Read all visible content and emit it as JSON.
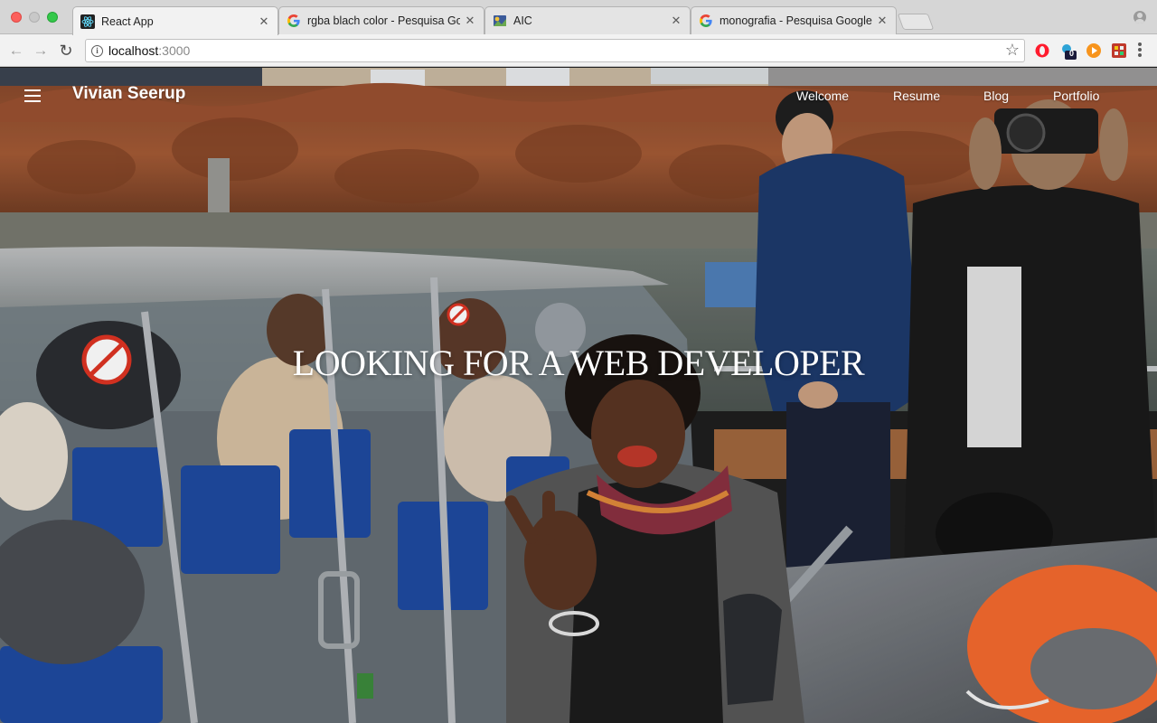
{
  "browser": {
    "tabs": [
      {
        "title": "React App",
        "favicon": "react-icon",
        "active": true
      },
      {
        "title": "rgba blach color - Pesquisa Go",
        "favicon": "google-icon",
        "active": false
      },
      {
        "title": "AIC",
        "favicon": "aic-icon",
        "active": false
      },
      {
        "title": "monografia - Pesquisa Google",
        "favicon": "google-icon",
        "active": false
      }
    ],
    "address": {
      "host": "localhost",
      "port": ":3000"
    },
    "extensions": [
      "opera-icon",
      "extension-badge-icon",
      "play-icon",
      "puzzle-icon"
    ],
    "extension_badge": "0"
  },
  "site": {
    "brand": "Vivian Seerup",
    "nav": [
      {
        "label": "Welcome"
      },
      {
        "label": "Resume"
      },
      {
        "label": "Blog"
      },
      {
        "label": "Portfolio"
      }
    ],
    "headline": "LOOKING FOR A WEB DEVELOPER"
  }
}
